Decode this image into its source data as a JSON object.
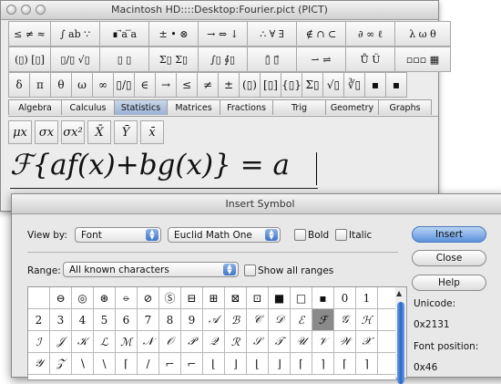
{
  "main_window": {
    "title": "Macintosh HD::::Desktop:Fourier.pict (PICT)",
    "palette_row1": [
      "≤ ≠ ≈",
      "∫ ab ∵",
      "∎ ⃗a ⃛a",
      "± • ⊗",
      "→ ⇔ ↓",
      "∴ ∀ ∃",
      "∉ ∩ ⊂",
      "∂ ∞ ℓ",
      "λ ω θ"
    ],
    "palette_row2": [
      "(▯) [▯]",
      "▯/▯ √▯",
      "▯ ▯",
      "Σ▯ Σ▯",
      "∫▯ ∮▯",
      "▯̄ ▯⃗",
      "⇀ ⇌",
      "Ů Ü",
      "▫▫▫ ▦"
    ],
    "palette_row3": [
      "δ",
      "π",
      "θ",
      "ω",
      "∞",
      "▯/▯",
      "∈",
      "→",
      "≤",
      "≠",
      "±",
      "(▯)",
      "[▯]",
      "{▯}",
      "Σ▯",
      "√▯",
      "∛▯",
      "▪",
      "▪"
    ],
    "tabs": [
      "Algebra",
      "Calculus",
      "Statistics",
      "Matrices",
      "Fractions",
      "Trig",
      "Geometry",
      "Graphs"
    ],
    "selected_tab": "Statistics",
    "stat_buttons": [
      "μx",
      "σx",
      "σx²",
      "X̄",
      "Ȳ",
      "x̄"
    ],
    "equation": "ℱ{af(x)+bg(x)} = a"
  },
  "dialog": {
    "title": "Insert Symbol",
    "view_by_label": "View by:",
    "view_by_value": "Font",
    "font_value": "Euclid Math One",
    "bold_label": "Bold",
    "italic_label": "Italic",
    "range_label": "Range:",
    "range_value": "All known characters",
    "show_all_label": "Show all ranges",
    "insert_button": "Insert",
    "close_button": "Close",
    "help_button": "Help",
    "unicode_label": "Unicode:",
    "unicode_value": "0x2131",
    "font_position_label": "Font position:",
    "font_position_value": "0x46",
    "grid_rows": [
      [
        "",
        "⊖",
        "◎",
        "⊛",
        "⦵",
        "⊘",
        "Ⓢ",
        "⊟",
        "⊞",
        "⊠",
        "⊡",
        "■",
        "□",
        "▪",
        "0",
        "1"
      ],
      [
        "2",
        "3",
        "4",
        "5",
        "6",
        "7",
        "8",
        "9",
        "𝒜",
        "ℬ",
        "𝒞",
        "𝒟",
        "ℰ",
        "ℱ",
        "𝒢",
        "ℋ"
      ],
      [
        "ℐ",
        "𝒥",
        "𝒦",
        "ℒ",
        "ℳ",
        "𝒩",
        "𝒪",
        "𝒫",
        "𝒬",
        "ℛ",
        "𝒮",
        "𝒯",
        "𝒰",
        "𝒱",
        "𝒲",
        "𝒳"
      ],
      [
        "𝒴",
        "𝒵",
        "∖",
        "\\",
        "⌈",
        "/",
        "⌐",
        "⌐",
        "⌊",
        "⌋",
        "⌊",
        "⌋",
        "⌈",
        "⌉",
        "⌈",
        "⌉"
      ]
    ],
    "selected_cell": "ℱ"
  }
}
